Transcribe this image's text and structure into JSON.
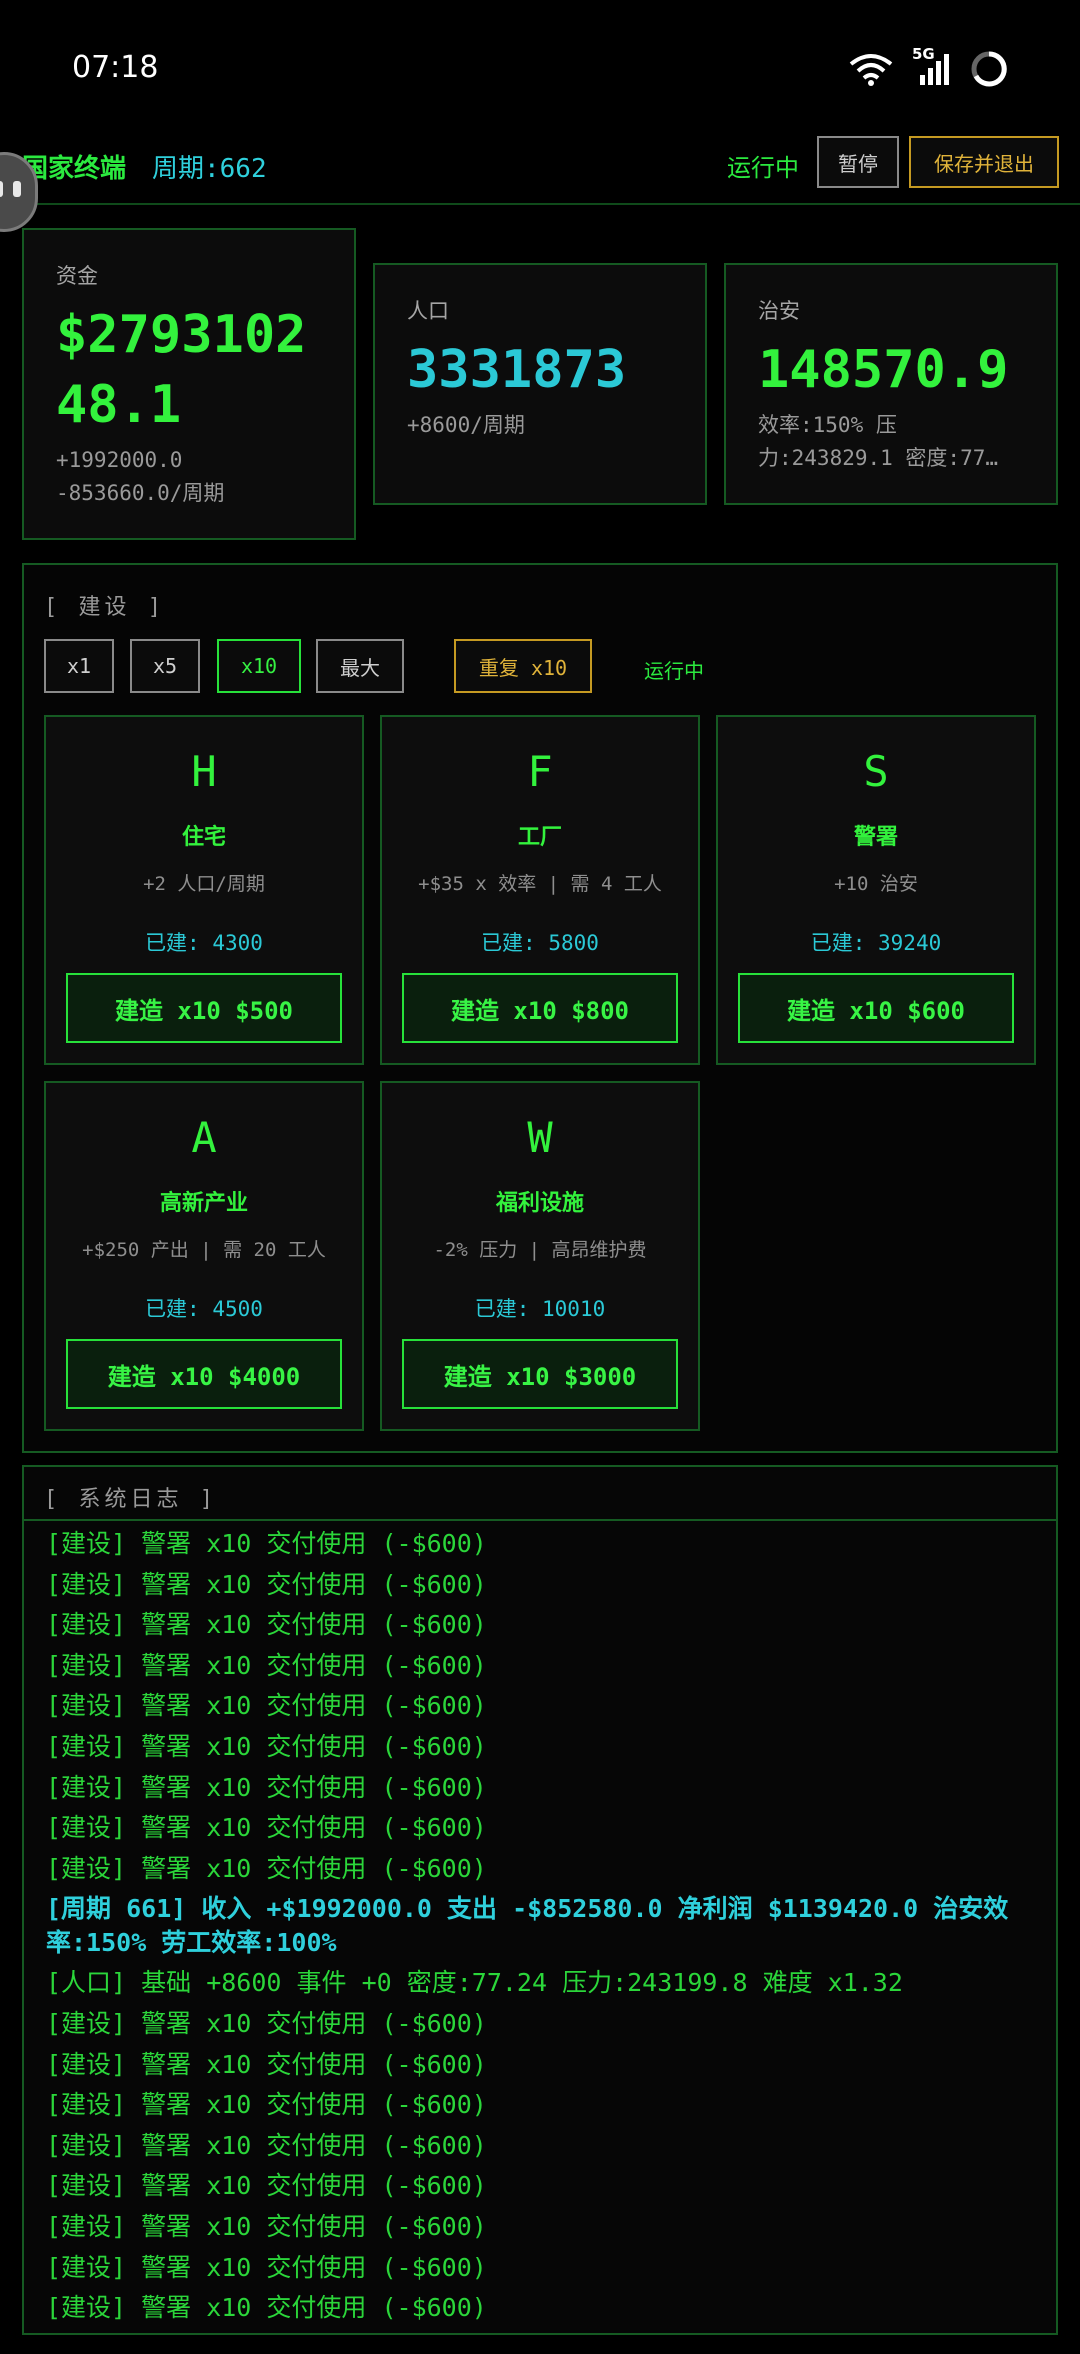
{
  "status": {
    "time": "07:18",
    "net": "5G"
  },
  "header": {
    "app_title": "国家终端",
    "cycle": "周期:662",
    "run_state": "运行中",
    "pause_label": "暂停",
    "save_label": "保存并退出"
  },
  "stats": {
    "funds": {
      "label": "资金",
      "value": "$2793102 48.1",
      "value_l1": "$2793102",
      "value_l2": "48.1",
      "income": "+1992000.0",
      "expense": "-853660.0/周期"
    },
    "population": {
      "label": "人口",
      "value": "3331873",
      "delta": "+8600/周期"
    },
    "security": {
      "label": "治安",
      "value": "148570.9",
      "detail_l1": "效率:150% 压",
      "detail_l2": "力:243829.1 密度:77…"
    }
  },
  "build": {
    "title": "[ 建设 ]",
    "multipliers": [
      {
        "label": "x1"
      },
      {
        "label": "x5"
      },
      {
        "label": "x10",
        "active": true
      },
      {
        "label": "最大"
      }
    ],
    "repeat_label": "重复 x10",
    "status": "运行中",
    "buildings": [
      {
        "letter": "H",
        "name": "住宅",
        "desc": "+2 人口/周期",
        "built": "已建: 4300",
        "button": "建造 x10  $500"
      },
      {
        "letter": "F",
        "name": "工厂",
        "desc": "+$35 x 效率 | 需 4 工人",
        "built": "已建: 5800",
        "button": "建造 x10  $800"
      },
      {
        "letter": "S",
        "name": "警署",
        "desc": "+10 治安",
        "built": "已建: 39240",
        "button": "建造 x10  $600"
      },
      {
        "letter": "A",
        "name": "高新产业",
        "desc": "+$250 产出 | 需 20 工人",
        "built": "已建: 4500",
        "button": "建造 x10  $4000"
      },
      {
        "letter": "W",
        "name": "福利设施",
        "desc": "-2% 压力 | 高昂维护费",
        "built": "已建: 10010",
        "button": "建造 x10  $3000"
      }
    ]
  },
  "log": {
    "title": "[ 系统日志 ]",
    "lines": [
      {
        "text": "[建设] 警署 x10 交付使用 (-$600)"
      },
      {
        "text": "[建设] 警署 x10 交付使用 (-$600)"
      },
      {
        "text": "[建设] 警署 x10 交付使用 (-$600)"
      },
      {
        "text": "[建设] 警署 x10 交付使用 (-$600)"
      },
      {
        "text": "[建设] 警署 x10 交付使用 (-$600)"
      },
      {
        "text": "[建设] 警署 x10 交付使用 (-$600)"
      },
      {
        "text": "[建设] 警署 x10 交付使用 (-$600)"
      },
      {
        "text": "[建设] 警署 x10 交付使用 (-$600)"
      },
      {
        "text": "[建设] 警署 x10 交付使用 (-$600)"
      },
      {
        "text": "[周期 661] 收入 +$1992000.0 支出 -$852580.0 净利润 $1139420.0 治安效率:150% 劳工效率:100%",
        "type": "cycle"
      },
      {
        "text": "[人口] 基础 +8600 事件 +0 密度:77.24 压力:243199.8 难度 x1.32"
      },
      {
        "text": "[建设] 警署 x10 交付使用 (-$600)"
      },
      {
        "text": "[建设] 警署 x10 交付使用 (-$600)"
      },
      {
        "text": "[建设] 警署 x10 交付使用 (-$600)"
      },
      {
        "text": "[建设] 警署 x10 交付使用 (-$600)"
      },
      {
        "text": "[建设] 警署 x10 交付使用 (-$600)"
      },
      {
        "text": "[建设] 警署 x10 交付使用 (-$600)"
      },
      {
        "text": "[建设] 警署 x10 交付使用 (-$600)"
      },
      {
        "text": "[建设] 警署 x10 交付使用 (-$600)"
      }
    ]
  },
  "colors": {
    "accent_green": "#27e13a",
    "accent_cyan": "#2bc9d6",
    "accent_gold": "#c59a22",
    "background": "#000000"
  }
}
